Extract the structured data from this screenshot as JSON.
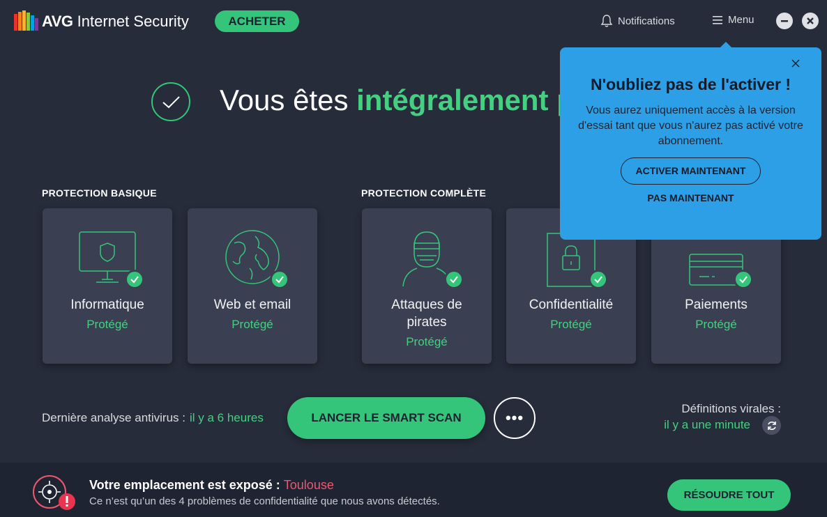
{
  "app": {
    "brand": "AVG",
    "product": "Internet Security",
    "buy_label": "ACHETER",
    "notifications_label": "Notifications",
    "menu_label": "Menu"
  },
  "hero": {
    "prefix": "Vous êtes ",
    "accent": "intégralement p"
  },
  "sections": {
    "basic_label": "PROTECTION BASIQUE",
    "full_label": "PROTECTION COMPLÈTE"
  },
  "cards": [
    {
      "title": "Informatique",
      "status": "Protégé",
      "icon": "computer-shield-icon"
    },
    {
      "title": "Web et email",
      "status": "Protégé",
      "icon": "globe-icon"
    },
    {
      "title": "Attaques de pirates",
      "status": "Protégé",
      "icon": "hacker-icon"
    },
    {
      "title": "Confidentialité",
      "status": "Protégé",
      "icon": "lock-icon"
    },
    {
      "title": "Paiements",
      "status": "Protégé",
      "icon": "credit-card-icon"
    }
  ],
  "scan": {
    "last_label": "Dernière analyse antivirus :",
    "last_value": "il y a 6 heures",
    "button_label": "LANCER LE SMART SCAN",
    "more_label": "•••",
    "defs_label": "Définitions virales :",
    "defs_value": "il y a une minute"
  },
  "privacy": {
    "title": "Votre emplacement est exposé : ",
    "city": "Toulouse",
    "subtitle": "Ce n’est qu’un des 4 problèmes de confidentialité que nous avons détectés.",
    "button_label": "RÉSOUDRE TOUT"
  },
  "popup": {
    "title": "N'oubliez pas de l'activer !",
    "text": "Vous aurez uniquement accès à la version d'essai tant que vous n'aurez pas activé votre abonnement.",
    "primary_label": "ACTIVER MAINTENANT",
    "secondary_label": "PAS MAINTENANT"
  },
  "colors": {
    "background": "#262c3a",
    "card": "#3a4052",
    "accent_green": "#35c57a",
    "popup_blue": "#2c9fe6",
    "alert_red": "#f0566f"
  }
}
